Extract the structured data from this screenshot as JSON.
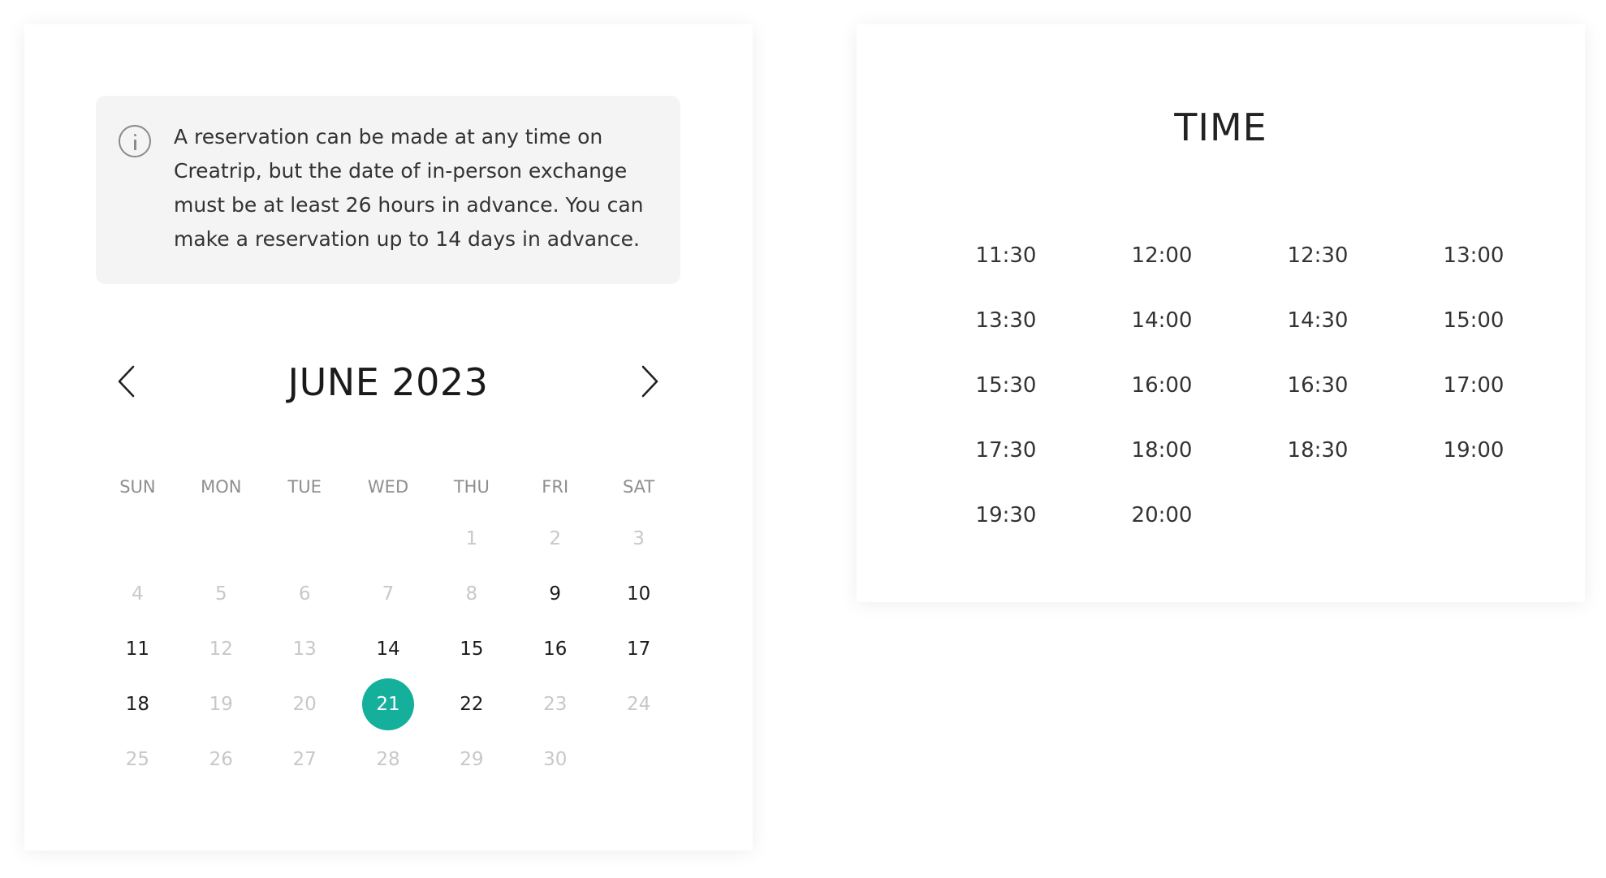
{
  "notice": {
    "icon": "info-icon",
    "text": "A reservation can be made at any time on Creatrip, but the date of in-person exchange must be at least 26 hours in advance. You can make a reservation up to 14 days in advance."
  },
  "calendar": {
    "month_label": "JUNE 2023",
    "prev_icon": "chevron-left-icon",
    "next_icon": "chevron-right-icon",
    "weekdays": [
      "SUN",
      "MON",
      "TUE",
      "WED",
      "THU",
      "FRI",
      "SAT"
    ],
    "weeks": [
      [
        "",
        "",
        "",
        "",
        "1",
        "2",
        "3"
      ],
      [
        "4",
        "5",
        "6",
        "7",
        "8",
        "9",
        "10"
      ],
      [
        "11",
        "12",
        "13",
        "14",
        "15",
        "16",
        "17"
      ],
      [
        "18",
        "19",
        "20",
        "21",
        "22",
        "23",
        "24"
      ],
      [
        "25",
        "26",
        "27",
        "28",
        "29",
        "30",
        ""
      ]
    ],
    "available_days": [
      "9",
      "10",
      "11",
      "14",
      "15",
      "16",
      "17",
      "18",
      "21",
      "22"
    ],
    "selected_day": "21",
    "accent_color": "#14b09c"
  },
  "time": {
    "title": "TIME",
    "slots": [
      "11:30",
      "12:00",
      "12:30",
      "13:00",
      "13:30",
      "14:00",
      "14:30",
      "15:00",
      "15:30",
      "16:00",
      "16:30",
      "17:00",
      "17:30",
      "18:00",
      "18:30",
      "19:00",
      "19:30",
      "20:00"
    ]
  }
}
